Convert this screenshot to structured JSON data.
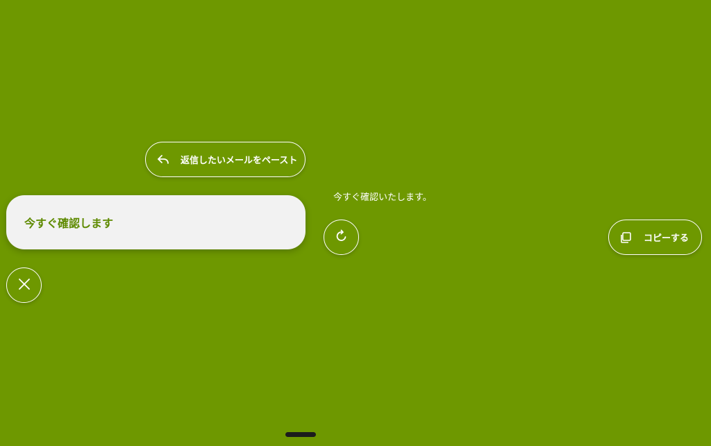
{
  "paste_button": {
    "label": "返信したいメールをペースト",
    "icon": "reply-icon"
  },
  "input": {
    "value": "今すぐ確認します"
  },
  "close_button": {
    "icon": "close-icon"
  },
  "result": {
    "text": "今すぐ確認いたします。"
  },
  "refresh_button": {
    "icon": "refresh-icon"
  },
  "copy_button": {
    "label": "コピーする",
    "icon": "copy-icon"
  },
  "colors": {
    "background": "#6e9800",
    "card": "#f2f2f2",
    "accent_text": "#5e8a00"
  }
}
